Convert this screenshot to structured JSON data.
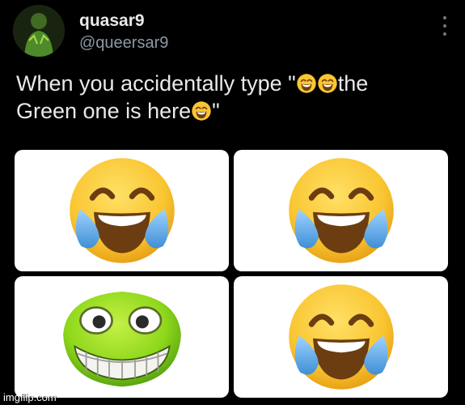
{
  "post": {
    "display_name": "quasar9",
    "handle": "@queersar9",
    "text_line1_a": "When you accidentally type \"",
    "text_line1_b": "the",
    "text_line2_a": "Green one is here",
    "text_line2_b": "\"",
    "inline_emoji": "laughing-crying-face-icon"
  },
  "meme": {
    "panels": [
      {
        "icon": "face-with-tears-of-joy-icon"
      },
      {
        "icon": "face-with-tears-of-joy-icon"
      },
      {
        "icon": "green-grinning-creature-icon"
      },
      {
        "icon": "face-with-tears-of-joy-icon"
      }
    ]
  },
  "watermark": "imgflip.com",
  "colors": {
    "background": "#000000",
    "text": "#e7e9ea",
    "secondary_text": "#8b98a5",
    "emoji_yellow": "#f9c531",
    "tear_blue": "#5aaee8",
    "creature_green": "#8fd81c"
  }
}
